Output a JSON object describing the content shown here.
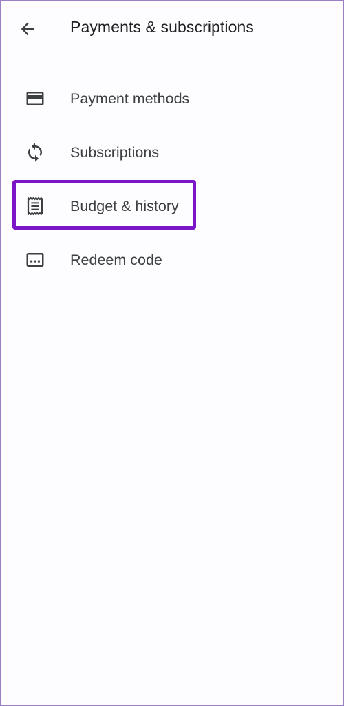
{
  "header": {
    "title": "Payments & subscriptions",
    "back_icon": "arrow-back-icon"
  },
  "menu": {
    "items": [
      {
        "label": "Payment methods",
        "icon": "credit-card-icon"
      },
      {
        "label": "Subscriptions",
        "icon": "sync-icon"
      },
      {
        "label": "Budget & history",
        "icon": "receipt-icon",
        "highlighted": true
      },
      {
        "label": "Redeem code",
        "icon": "redeem-code-icon"
      }
    ]
  },
  "colors": {
    "highlight": "#7a16c7",
    "text": "#3c4043",
    "icon": "#3c4043",
    "frame_border": "#9b7fc4"
  }
}
